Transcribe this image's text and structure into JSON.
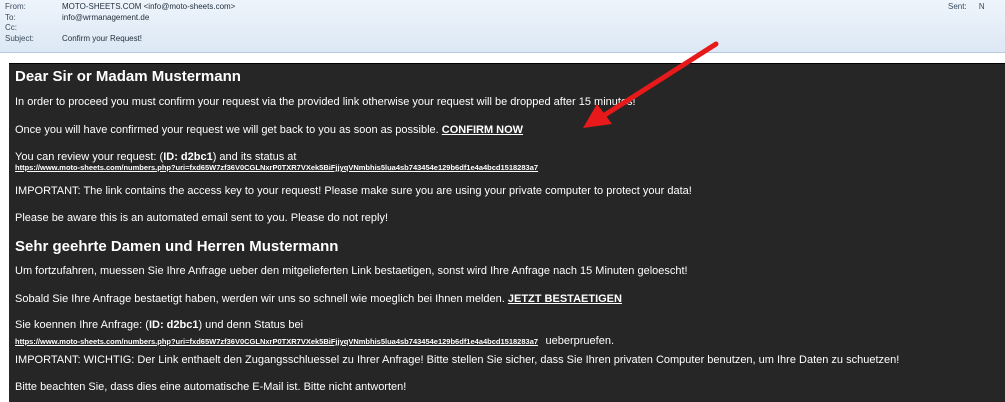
{
  "header": {
    "from_label": "From:",
    "from_value": "MOTO-SHEETS.COM <info@moto-sheets.com>",
    "to_label": "To:",
    "to_value": "info@wrmanagement.de",
    "cc_label": "Cc:",
    "cc_value": "",
    "subject_label": "Subject:",
    "subject_value": "Confirm your Request!",
    "sent_label": "Sent:",
    "sent_value": "N"
  },
  "body": {
    "en": {
      "greeting": "Dear Sir or Madam Mustermann",
      "line1": "In order to proceed you must confirm your request via the provided link otherwise your request will be dropped after 15 minutes!",
      "line2": "Once you will have confirmed your request we will get back to you as soon as possible.",
      "confirm_link": "CONFIRM NOW",
      "review_prefix": "You can review your request: (",
      "id_label": "ID: d2bc1",
      "review_suffix": ") and its status at",
      "review_url": "https://www.moto-sheets.com/numbers.php?uri=fxd65W7zf36V0CGLNxrP0TXR7VXek5BiFjjyqVNmbhis5lua4sb743454e129b6df1e4a4bcd1518283a7",
      "important": "IMPORTANT: The link contains the access key to your request! Please make sure you are using your private computer to protect your data!",
      "automated": "Please be aware this is an automated email sent to you. Please do not reply!"
    },
    "de": {
      "greeting": "Sehr geehrte Damen und Herren Mustermann",
      "line1": "Um fortzufahren, muessen Sie Ihre Anfrage ueber den mitgelieferten Link bestaetigen, sonst wird Ihre Anfrage nach 15 Minuten geloescht!",
      "line2": "Sobald Sie Ihre Anfrage bestaetigt haben, werden wir uns so schnell wie moeglich bei Ihnen melden.",
      "confirm_link": "JETZT BESTAETIGEN",
      "review_prefix": "Sie koennen Ihre Anfrage: (",
      "id_label": "ID: d2bc1",
      "review_suffix": ") und denn Status bei",
      "review_url": "https://www.moto-sheets.com/numbers.php?uri=fxd65W7zf36V0CGLNxrP0TXR7VXek5BiFjjyqVNmbhis5lua4sb743454e129b6df1e4a4bcd1518283a7",
      "review_url_suffix": "ueberpruefen.",
      "important": "IMPORTANT: WICHTIG: Der Link enthaelt den Zugangsschluessel zu Ihrer Anfrage! Bitte stellen Sie sicher, dass Sie Ihren privaten Computer benutzen, um Ihre Daten zu schuetzen!",
      "automated": "Bitte beachten Sie, dass dies eine automatische E-Mail ist. Bitte nicht antworten!"
    }
  },
  "colors": {
    "panel_bg": "#262626",
    "text": "#ffffff",
    "arrow": "#e8191b",
    "header_bg": "#e4edf7"
  }
}
